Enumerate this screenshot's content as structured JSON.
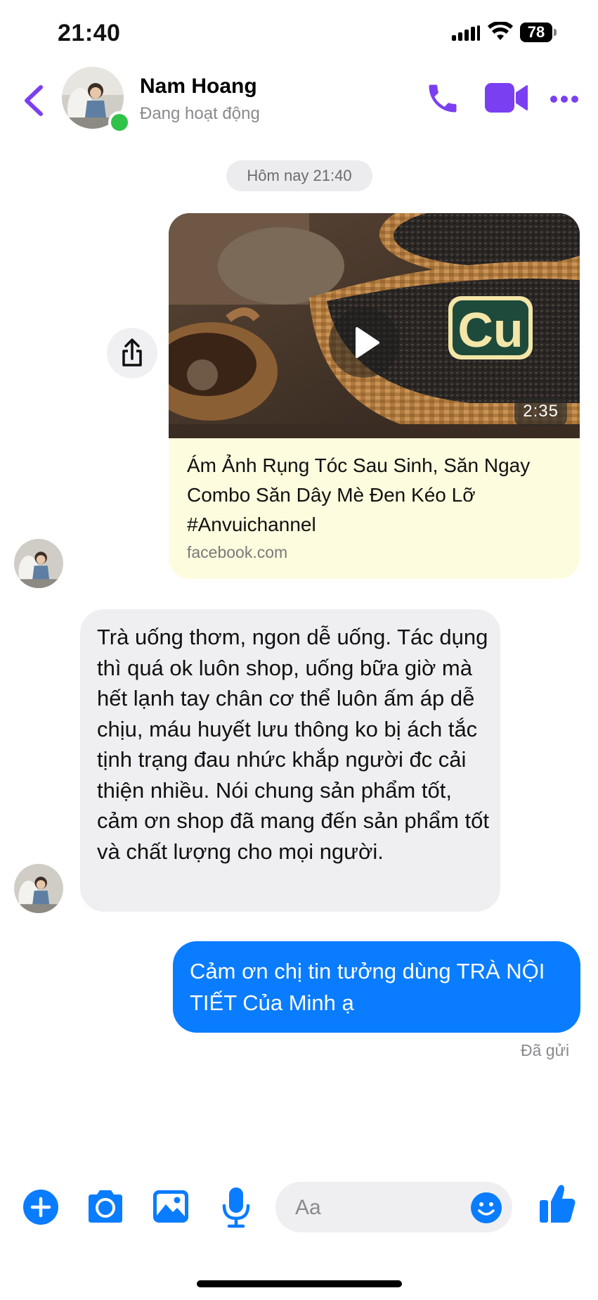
{
  "status_bar": {
    "time": "21:40",
    "battery": "78"
  },
  "header": {
    "contact_name": "Nam Hoang",
    "contact_status": "Đang hoạt động",
    "icons": [
      "back-chevron-icon",
      "phone-icon",
      "video-camera-icon",
      "more-icon"
    ]
  },
  "conversation": {
    "timestamp": "Hôm nay 21:40",
    "shared_video": {
      "title": "Ám Ảnh Rụng Tóc Sau Sinh, Săn Ngay Combo Săn Dây Mè Đen Kéo Lỡ #Anvuichannel",
      "domain": "facebook.com",
      "duration": "2:35",
      "logo_text": "Cu"
    },
    "incoming_message": "Trà uống thơm, ngon dễ uống. Tác dụng thì quá ok luôn shop, uống bữa giờ mà hết lạnh tay chân cơ thể luôn ấm áp dễ chịu, máu huyết lưu thông ko bị ách tắc tịnh trạng đau nhức khắp người đc cải thiện nhiều.  Nói chung sản phẩm tốt, cảm ơn shop đã mang đến sản phẩm tốt và chất lượng cho mọi người.",
    "outgoing_message": "Cảm ơn chị tin tưởng dùng TRÀ NỘI TIẾT Của Minh ạ",
    "delivery_status": "Đã gửi"
  },
  "composer": {
    "placeholder": "Aa",
    "icons": [
      "add-icon",
      "camera-icon",
      "gallery-icon",
      "microphone-icon",
      "emoji-icon",
      "thumbs-up-icon"
    ]
  },
  "colors": {
    "accent_purple": "#7b3ff2",
    "messenger_blue": "#0a7cff",
    "online_green": "#31c24a"
  }
}
